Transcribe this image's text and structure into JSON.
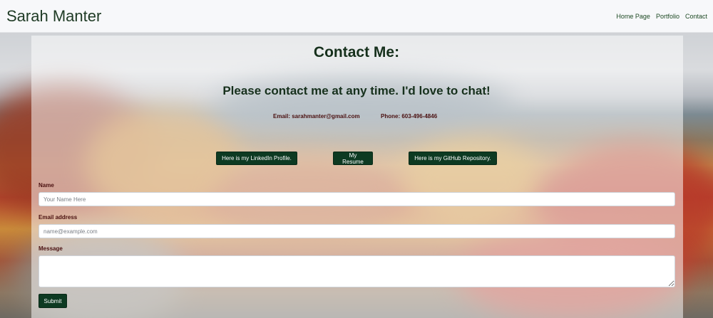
{
  "navbar": {
    "brand": "Sarah Manter",
    "links": [
      "Home Page",
      "Portfolio",
      "Contact"
    ]
  },
  "main": {
    "title": "Contact Me:",
    "subtitle": "Please contact me at any time. I'd love to chat!",
    "email": "Email: sarahmanter@gmail.com",
    "phone": "Phone: 603-496-4846",
    "buttons": {
      "linkedin": "Here is my LinkedIn Profile.",
      "resume": "My Resume",
      "github": "Here is my GitHub Repository."
    }
  },
  "form": {
    "name_label": "Name",
    "name_placeholder": "Your Name Here",
    "email_label": "Email address",
    "email_placeholder": "name@example.com",
    "message_label": "Message",
    "submit_label": "Submit"
  },
  "colors": {
    "button_bg": "#0d3a22",
    "heading": "#16301c",
    "label": "#4a1010",
    "navbar_bg": "#f7f8fa"
  }
}
